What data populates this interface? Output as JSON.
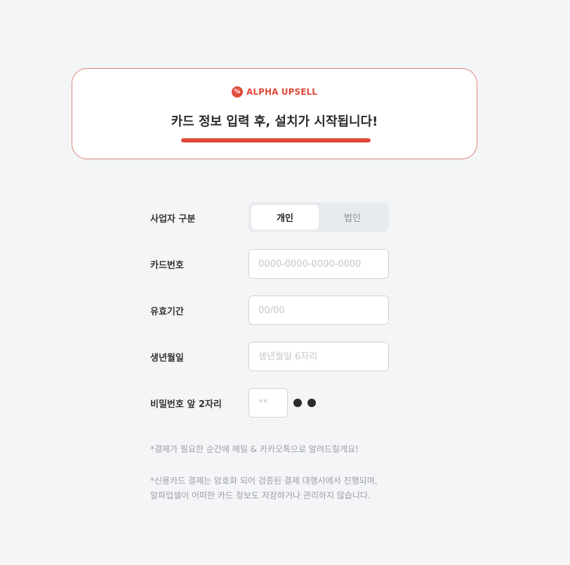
{
  "banner": {
    "brand_icon": "%",
    "brand_name": "ALPHA UPSELL",
    "headline": "카드 정보 입력 후, 설치가 시작됩니다!"
  },
  "form": {
    "business_type": {
      "label": "사업자 구분",
      "options": [
        "개인",
        "법인"
      ],
      "selected": "개인"
    },
    "card_number": {
      "label": "카드번호",
      "placeholder": "0000-0000-0000-0000",
      "value": ""
    },
    "expiry": {
      "label": "유효기간",
      "placeholder": "00/00",
      "value": ""
    },
    "birthdate": {
      "label": "생년월일",
      "placeholder": "생년월일 6자리",
      "value": ""
    },
    "password": {
      "label": "비밀번호 앞 2자리",
      "placeholder": "**",
      "value": ""
    }
  },
  "notes": {
    "line1": "*결제가 필요한 순간에 메일 & 카카오톡으로 알려드릴게요!",
    "line2": "*신용카드 결제는 암호화 되어 검증된 결제 대행사에서 진행되며,",
    "line3": "알파업셀이 어떠한 카드 정보도 저장하거나 관리하지 않습니다."
  },
  "colors": {
    "accent": "#e04a3a",
    "banner_border": "#d9847a",
    "background": "#f4f5f7"
  }
}
